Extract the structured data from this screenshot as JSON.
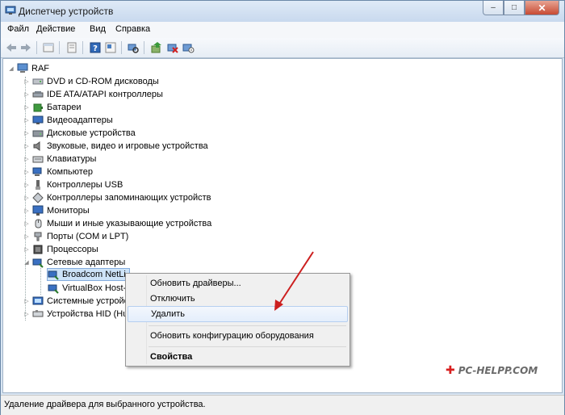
{
  "window": {
    "title": "Диспетчер устройств",
    "buttons": {
      "minimize": "–",
      "maximize": "□",
      "close": "✕"
    }
  },
  "menu": [
    "Файл",
    "Действие",
    "Вид",
    "Справка"
  ],
  "toolbar": {
    "icons": [
      "back-icon",
      "forward-icon",
      "up-icon",
      "properties-icon",
      "help-icon",
      "show-hidden-icon",
      "scan-hardware-icon",
      "update-driver-icon",
      "uninstall-icon",
      "disable-icon"
    ]
  },
  "tree": {
    "root": "RAF",
    "categories": [
      "DVD и CD-ROM дисководы",
      "IDE ATA/ATAPI контроллеры",
      "Батареи",
      "Видеоадаптеры",
      "Дисковые устройства",
      "Звуковые, видео и игровые устройства",
      "Клавиатуры",
      "Компьютер",
      "Контроллеры USB",
      "Контроллеры запоминающих устройств",
      "Мониторы",
      "Мыши и иные указывающие устройства",
      "Порты (COM и LPT)",
      "Процессоры",
      "Сетевые адаптеры"
    ],
    "network_children": [
      "Broadcom NetLink (TM) Gigabit Ethernet",
      "VirtualBox Host-Only Ethernet Adapter"
    ],
    "network_children_visible": [
      "Broadcom NetLi",
      "VirtualBox Host-("
    ],
    "after": [
      "Системные устройства",
      "Устройства HID (Human Interface Devices)"
    ],
    "after_visible": [
      "Системные устройс",
      "Устройства HID (Hu"
    ]
  },
  "context_menu": {
    "items": [
      "Обновить драйверы...",
      "Отключить",
      "Удалить",
      "Обновить конфигурацию оборудования",
      "Свойства"
    ],
    "hover_index": 2,
    "bold_index": 4
  },
  "status": "Удаление драйвера для выбранного устройства.",
  "watermark": {
    "plus": "✚",
    "text": "PC-HELPP.COM"
  },
  "colors": {
    "selection": "#cde3f8",
    "arrow": "#cc1f1f"
  }
}
